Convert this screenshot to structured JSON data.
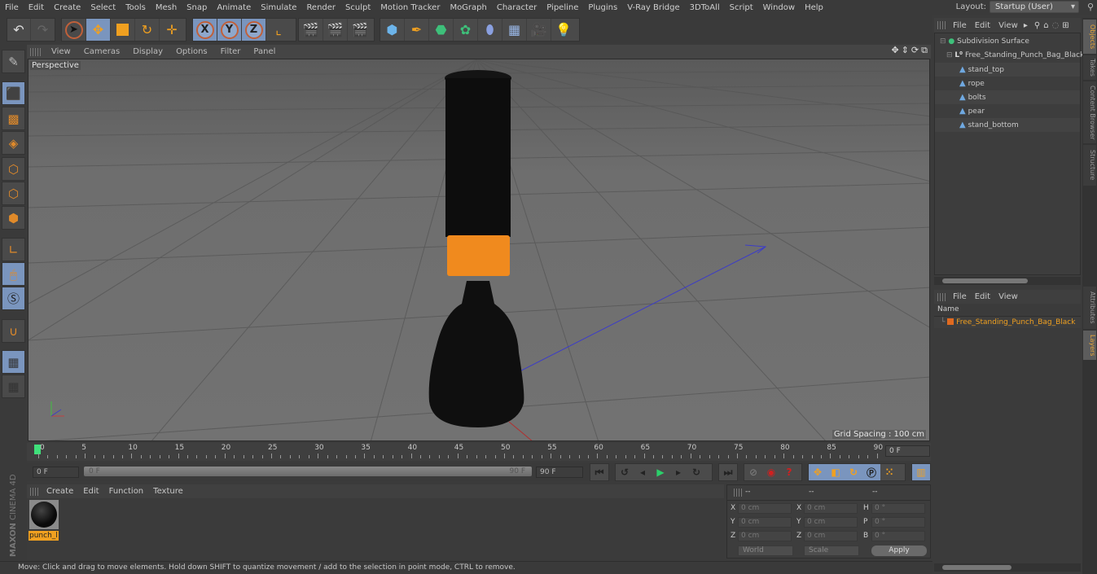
{
  "menubar": {
    "items": [
      "File",
      "Edit",
      "Create",
      "Select",
      "Tools",
      "Mesh",
      "Snap",
      "Animate",
      "Simulate",
      "Render",
      "Sculpt",
      "Motion Tracker",
      "MoGraph",
      "Character",
      "Pipeline",
      "Plugins",
      "V-Ray Bridge",
      "3DToAll",
      "Script",
      "Window",
      "Help"
    ],
    "layout_label": "Layout:",
    "layout_value": "Startup (User)"
  },
  "viewport": {
    "menu": [
      "View",
      "Cameras",
      "Display",
      "Options",
      "Filter",
      "Panel"
    ],
    "camera_label": "Perspective",
    "grid_spacing": "Grid Spacing : 100 cm",
    "colors": {
      "bag": "#0d0d0d",
      "band": "#f08a1e"
    }
  },
  "timeline": {
    "ticks": [
      "0",
      "5",
      "10",
      "15",
      "20",
      "25",
      "30",
      "35",
      "40",
      "45",
      "50",
      "55",
      "60",
      "65",
      "70",
      "75",
      "80",
      "85",
      "90"
    ],
    "current_frame": "0 F",
    "start_field": "0 F",
    "slider_start": "0 F",
    "slider_end": "90 F",
    "end_field": "90 F"
  },
  "material_manager": {
    "menu": [
      "Create",
      "Edit",
      "Function",
      "Texture"
    ],
    "materials": [
      {
        "name": "punch_l"
      }
    ]
  },
  "coordinates": {
    "headers": [
      "--",
      "--",
      "--"
    ],
    "rows": [
      {
        "l1": "X",
        "v1": "0 cm",
        "l2": "X",
        "v2": "0 cm",
        "l3": "H",
        "v3": "0 °"
      },
      {
        "l1": "Y",
        "v1": "0 cm",
        "l2": "Y",
        "v2": "0 cm",
        "l3": "P",
        "v3": "0 °"
      },
      {
        "l1": "Z",
        "v1": "0 cm",
        "l2": "Z",
        "v2": "0 cm",
        "l3": "B",
        "v3": "0 °"
      }
    ],
    "mode": "World",
    "transform": "Scale",
    "apply": "Apply"
  },
  "status": "Move: Click and drag to move elements. Hold down SHIFT to quantize movement / add to the selection in point mode, CTRL to remove.",
  "objects": {
    "menu": [
      "File",
      "Edit",
      "View"
    ],
    "tree": [
      {
        "name": "Subdivision Surface",
        "icon": "subdivision-icon"
      },
      {
        "name": "Free_Standing_Punch_Bag_Black",
        "icon": "null-icon"
      },
      {
        "name": "stand_top",
        "icon": "polygon-icon"
      },
      {
        "name": "rope",
        "icon": "polygon-icon"
      },
      {
        "name": "bolts",
        "icon": "polygon-icon"
      },
      {
        "name": "pear",
        "icon": "polygon-icon"
      },
      {
        "name": "stand_bottom",
        "icon": "polygon-icon"
      }
    ]
  },
  "layers": {
    "menu": [
      "File",
      "Edit",
      "View"
    ],
    "column": "Name",
    "items": [
      {
        "name": "Free_Standing_Punch_Bag_Black",
        "color": "#e06a20"
      }
    ]
  },
  "side_tabs": [
    "Objects",
    "Takes",
    "Content Browser",
    "Structure",
    "Attributes",
    "Layers"
  ],
  "branding": {
    "maker": "MAXON",
    "product": "CINEMA 4D"
  }
}
